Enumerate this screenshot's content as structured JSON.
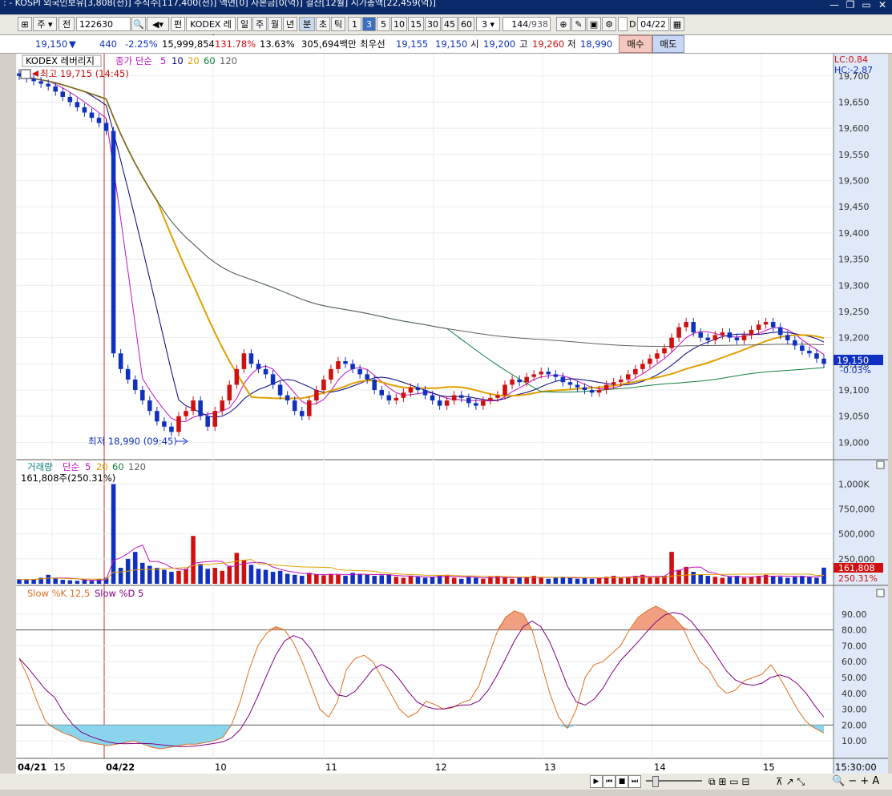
{
  "titlebar": {
    "text": ": - KOSPI 외국인보유[3,808(천)] 주식수[117,400(천)] 액면[0] 자본금[0(억)] 결산[12월] 시가총액[22,459(억)]",
    "minimize": "—",
    "maximize": "▭",
    "restore": "❐",
    "close": "✕"
  },
  "toolbar": {
    "type": "주",
    "prefix": "전",
    "code": "122630",
    "fund_label": "펀",
    "name": "KODEX 레버",
    "periods": [
      "일",
      "주",
      "월",
      "년",
      "분",
      "초",
      "틱"
    ],
    "selected_period": "분",
    "intervals": [
      "1",
      "3",
      "5",
      "10",
      "15",
      "30",
      "45",
      "60"
    ],
    "selected_interval": "3",
    "interval_box": "3",
    "count": "144",
    "total": "/938",
    "d_label": "D",
    "date": "04/22"
  },
  "quote": {
    "price": "19,150",
    "arrow": "▼",
    "change": "440",
    "pct": "-2.25%",
    "volume": "15,999,854",
    "vol_ratio": "131.78%",
    "turnover": "13.63%",
    "amount": "305,694백만",
    "best_label": "최우선",
    "ask": "19,155",
    "bid": "19,150",
    "open_label": "시",
    "open": "19,200",
    "high_label": "고",
    "high": "19,260",
    "low_label": "저",
    "low": "18,990",
    "buy": "매수",
    "sell": "매도"
  },
  "colors": {
    "up": "#d01010",
    "down": "#1030c0",
    "ma5": "#c010c0",
    "ma10": "#000080",
    "ma20": "#e0a000",
    "ma60": "#108040",
    "ma120": "#606060"
  },
  "price_panel": {
    "name": "KODEX 레버리지",
    "legend_prefix": "종가 단순",
    "legend": [
      "5",
      "10",
      "20",
      "60",
      "120"
    ],
    "lc": "LC:0.84",
    "hc": "HC:-2.87",
    "high_note": "최고 19,715 (14:45)",
    "low_note": "최저 18,990 (09:45)",
    "current": "19,150",
    "current_pct": "-0.03%",
    "y_ticks": [
      "19,700",
      "19,650",
      "19,600",
      "19,550",
      "19,500",
      "19,450",
      "19,400",
      "19,350",
      "19,300",
      "19,250",
      "19,200",
      "19,150",
      "19,100",
      "19,050",
      "19,000"
    ]
  },
  "volume_panel": {
    "legend_prefix": "거래량",
    "legend_simple": "단순",
    "legend": [
      "5",
      "20",
      "60",
      "120"
    ],
    "value": "161,808주(250.31%)",
    "y_ticks": [
      "1,000K",
      "750,000",
      "500,000",
      "250,000"
    ],
    "current": "161,808",
    "current_pct": "250.31%"
  },
  "stoch_panel": {
    "legend_k": "Slow %K 12,5",
    "legend_d": "Slow %D 5",
    "y_ticks": [
      "90.00",
      "80.00",
      "70.00",
      "60.00",
      "50.00",
      "40.00",
      "30.00",
      "20.00",
      "10.00"
    ]
  },
  "x_axis": {
    "labels": [
      {
        "t": "04/21",
        "bold": true
      },
      {
        "t": "15",
        "bold": false
      },
      {
        "t": "04/22",
        "bold": true
      },
      {
        "t": "10",
        "bold": false
      },
      {
        "t": "11",
        "bold": false
      },
      {
        "t": "12",
        "bold": false
      },
      {
        "t": "13",
        "bold": false
      },
      {
        "t": "14",
        "bold": false
      },
      {
        "t": "15",
        "bold": false
      }
    ],
    "time": "15:30:00"
  },
  "chart_data": {
    "type": "candlestick",
    "close": [
      19700,
      19695,
      19690,
      19685,
      19680,
      19670,
      19660,
      19650,
      19640,
      19630,
      19620,
      19610,
      19595,
      19170,
      19140,
      19120,
      19100,
      19080,
      19060,
      19040,
      19030,
      19020,
      19050,
      19060,
      19080,
      19050,
      19030,
      19060,
      19080,
      19110,
      19140,
      19170,
      19150,
      19140,
      19130,
      19110,
      19090,
      19080,
      19060,
      19050,
      19080,
      19100,
      19120,
      19140,
      19155,
      19150,
      19140,
      19130,
      19120,
      19100,
      19090,
      19080,
      19085,
      19095,
      19105,
      19100,
      19090,
      19080,
      19070,
      19080,
      19090,
      19085,
      19075,
      19070,
      19080,
      19085,
      19090,
      19110,
      19120,
      19115,
      19125,
      19130,
      19135,
      19130,
      19125,
      19115,
      19110,
      19105,
      19100,
      19095,
      19100,
      19110,
      19115,
      19120,
      19130,
      19140,
      19150,
      19160,
      19170,
      19180,
      19200,
      19220,
      19230,
      19210,
      19200,
      19195,
      19205,
      19210,
      19200,
      19195,
      19205,
      19215,
      19225,
      19230,
      19220,
      19205,
      19195,
      19185,
      19175,
      19170,
      19160,
      19150
    ],
    "ma_periods": [
      5,
      10,
      20,
      60,
      120
    ],
    "y_range": [
      18970,
      19715
    ],
    "volume": [
      45,
      40,
      48,
      60,
      90,
      55,
      40,
      35,
      30,
      40,
      30,
      50,
      60,
      1000,
      160,
      250,
      320,
      210,
      180,
      160,
      140,
      120,
      130,
      150,
      480,
      200,
      150,
      160,
      130,
      180,
      310,
      240,
      190,
      150,
      140,
      120,
      130,
      100,
      90,
      80,
      110,
      95,
      85,
      100,
      90,
      80,
      110,
      100,
      90,
      80,
      85,
      95,
      70,
      60,
      80,
      70,
      60,
      70,
      80,
      90,
      60,
      50,
      70,
      60,
      50,
      70,
      80,
      60,
      50,
      60,
      70,
      80,
      60,
      50,
      60,
      70,
      60,
      50,
      60,
      50,
      60,
      70,
      80,
      60,
      70,
      80,
      90,
      60,
      70,
      80,
      320,
      140,
      170,
      120,
      90,
      80,
      70,
      60,
      70,
      80,
      60,
      70,
      80,
      90,
      80,
      70,
      60,
      70,
      80,
      70,
      60,
      162
    ],
    "volume_range": [
      0,
      1100
    ],
    "slow_k": [
      62,
      50,
      35,
      22,
      18,
      15,
      13,
      10,
      9,
      8,
      7,
      8,
      9,
      10,
      8,
      6,
      5,
      6,
      7,
      8,
      8,
      9,
      10,
      12,
      20,
      35,
      55,
      70,
      78,
      82,
      80,
      72,
      60,
      45,
      30,
      25,
      35,
      55,
      62,
      64,
      60,
      50,
      40,
      30,
      25,
      28,
      35,
      33,
      30,
      31,
      34,
      36,
      45,
      62,
      78,
      88,
      92,
      90,
      80,
      60,
      40,
      25,
      18,
      30,
      50,
      58,
      60,
      65,
      70,
      80,
      88,
      92,
      95,
      92,
      88,
      82,
      70,
      60,
      55,
      45,
      40,
      42,
      48,
      50,
      52,
      58,
      50,
      40,
      30,
      22,
      18,
      15
    ]
  }
}
